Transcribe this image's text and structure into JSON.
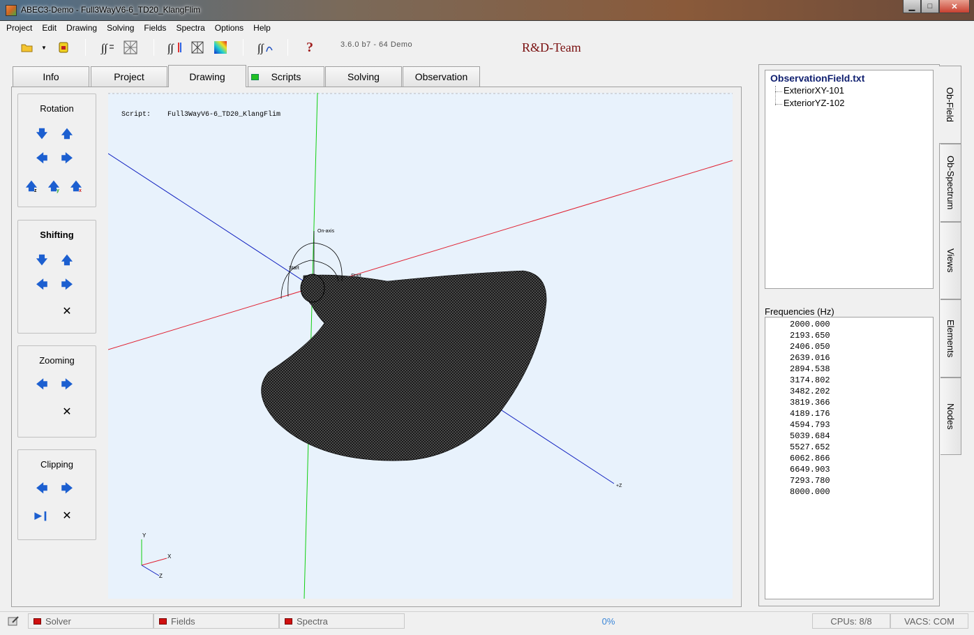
{
  "window": {
    "title": "ABEC3-Demo - Full3WayV6-6_TD20_KlangFlim"
  },
  "menu": [
    "Project",
    "Edit",
    "Drawing",
    "Solving",
    "Fields",
    "Spectra",
    "Options",
    "Help"
  ],
  "toolbar": {
    "version": "3.6.0 b7 - 64 Demo",
    "team": "R&D-Team"
  },
  "tabs": [
    "Info",
    "Project",
    "Drawing",
    "Scripts",
    "Solving",
    "Observation"
  ],
  "active_tab": "Drawing",
  "controls": {
    "rotation": "Rotation",
    "shifting": "Shifting",
    "zooming": "Zooming",
    "clipping": "Clipping"
  },
  "drawing": {
    "script_label": "Script:",
    "script_name": "Full3WayV6-6_TD20_KlangFlim",
    "labels": {
      "onaxis": "On-axis",
      "start1": "Start",
      "start2": "Start",
      "plusz": "+Z"
    },
    "triad": {
      "y": "Y",
      "x": "X",
      "z": "Z"
    },
    "axis_colors": {
      "x": "#e02030",
      "y": "#10d010",
      "z": "#1020c0"
    }
  },
  "observation_tree": {
    "root": "ObservationField.txt",
    "children": [
      "ExteriorXY-101",
      "ExteriorYZ-102"
    ]
  },
  "frequencies": {
    "label": "Frequencies  (Hz)",
    "values": [
      "2000.000",
      "2193.650",
      "2406.050",
      "2639.016",
      "2894.538",
      "3174.802",
      "3482.202",
      "3819.366",
      "4189.176",
      "4594.793",
      "5039.684",
      "5527.652",
      "6062.866",
      "6649.903",
      "7293.780",
      "8000.000"
    ]
  },
  "side_tabs": [
    "Ob-Field",
    "Ob-Spectrum",
    "Views",
    "Elements",
    "Nodes"
  ],
  "status": {
    "solver": "Solver",
    "fields": "Fields",
    "spectra": "Spectra",
    "progress": "0%",
    "cpus": "CPUs: 8/8",
    "vacs": "VACS: COM"
  }
}
